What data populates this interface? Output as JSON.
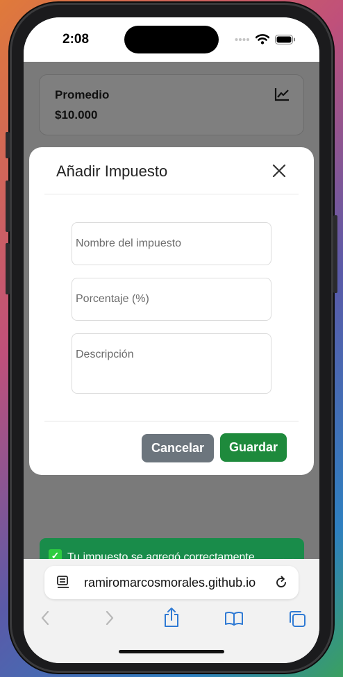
{
  "status_bar": {
    "time": "2:08"
  },
  "average_card": {
    "label": "Promedio",
    "value": "$10.000"
  },
  "modal": {
    "title": "Añadir Impuesto",
    "fields": {
      "name_placeholder": "Nombre del impuesto",
      "percent_placeholder": "Porcentaje (%)",
      "description_placeholder": "Descripción"
    },
    "cancel_label": "Cancelar",
    "save_label": "Guardar"
  },
  "toast": {
    "message": "Tu impuesto se agregó correctamente"
  },
  "browser": {
    "url": "ramiromarcosmorales.github.io"
  },
  "icons": {
    "chart": "chart-line-icon",
    "close": "close-icon",
    "check": "check-mark-icon",
    "site": "site-info-icon",
    "reload": "reload-icon",
    "back": "chevron-left-icon",
    "forward": "chevron-right-icon",
    "share": "share-icon",
    "bookmarks": "bookmarks-icon",
    "tabs": "tabs-icon"
  },
  "colors": {
    "save_button": "#1e8a3c",
    "cancel_button": "#6c757d",
    "toast_background": "#198c4a",
    "safari_accent": "#2f7ad4"
  }
}
